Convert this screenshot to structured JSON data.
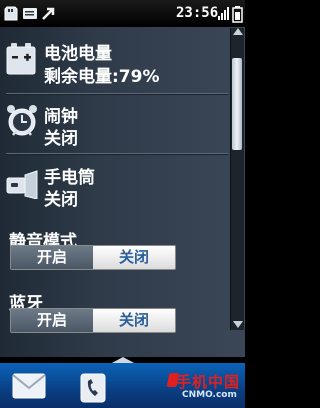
{
  "status_bar": {
    "time": "23:56",
    "icons": [
      "sd-card-icon",
      "contacts-card-icon",
      "missed-call-icon",
      "signal-icon",
      "battery-icon"
    ]
  },
  "settings": {
    "battery": {
      "title": "电池电量",
      "subtitle": "剩余电量:79%",
      "icon": "battery-icon",
      "percent": 79
    },
    "alarm": {
      "title": "闹钟",
      "subtitle": "关闭",
      "icon": "alarm-clock-icon"
    },
    "flashlight": {
      "title": "手电筒",
      "subtitle": "关闭",
      "icon": "flashlight-icon"
    },
    "silent_mode": {
      "title": "静音模式",
      "on_label": "开启",
      "off_label": "关闭",
      "selected": "关闭"
    },
    "bluetooth": {
      "title": "蓝牙",
      "on_label": "开启",
      "off_label": "关闭",
      "selected": "关闭"
    }
  },
  "dock": {
    "icons": [
      "message-icon",
      "phone-icon"
    ]
  },
  "watermark": {
    "cn": "手机中国",
    "en": "CNMO.com"
  },
  "colors": {
    "accent_blue": "#2a5f9a",
    "dock_blue": "#0b63b8",
    "brand_red": "#e02020"
  }
}
